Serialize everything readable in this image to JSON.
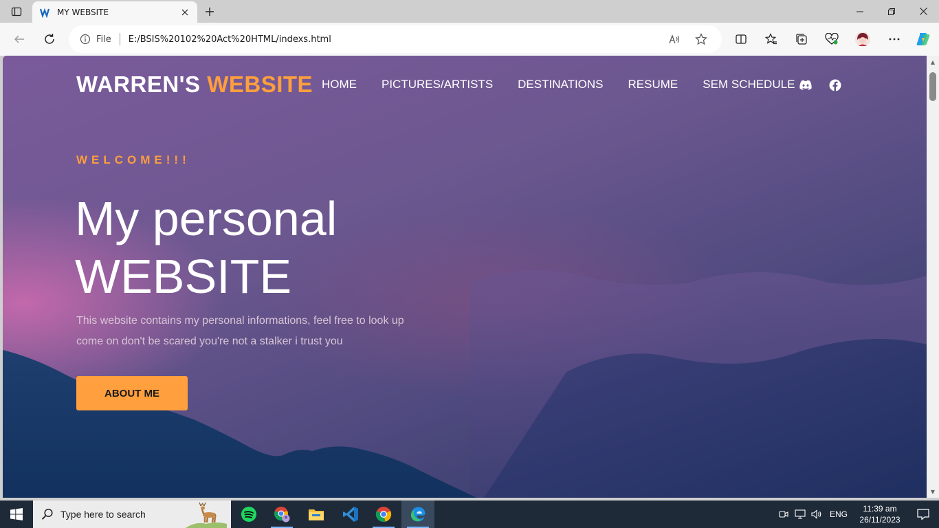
{
  "browser": {
    "tab_title": "MY WEBSITE",
    "site_info_label": "File",
    "url": "E:/BSIS%20102%20Act%20HTML/indexs.html"
  },
  "site": {
    "logo_main": "WARREN'S",
    "logo_accent": "WEBSITE",
    "nav": [
      {
        "label": "HOME"
      },
      {
        "label": "PICTURES/ARTISTS"
      },
      {
        "label": "DESTINATIONS"
      },
      {
        "label": "RESUME"
      },
      {
        "label": "SEM SCHEDULE"
      }
    ],
    "social_icons": [
      "discord-icon",
      "facebook-icon"
    ]
  },
  "hero": {
    "kicker": "WELCOME!!!",
    "title_line1": "My personal",
    "title_line2": "WEBSITE",
    "desc_line1": "This website contains my personal informations, feel free to look up",
    "desc_line2": "come on don't be scared you're not a stalker i trust you",
    "button_label": "ABOUT ME"
  },
  "taskbar": {
    "search_placeholder": "Type here to search",
    "apps": [
      "spotify-icon",
      "chrome-profile-icon",
      "file-explorer-icon",
      "vscode-icon",
      "chrome-icon",
      "edge-icon"
    ],
    "language": "ENG",
    "time": "11:39 am",
    "date": "26/11/2023"
  },
  "colors": {
    "accent": "#ff9f3d",
    "taskbar": "#1f2a38",
    "browser_chrome": "#f7f7f7"
  }
}
